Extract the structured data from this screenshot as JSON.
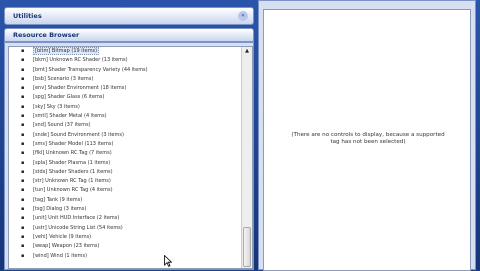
{
  "utilities": {
    "title": "Utilities",
    "toggle_glyph": "«"
  },
  "resource_browser": {
    "title": "Resource Browser",
    "items": [
      "[bitm] Bitmap (19 items)",
      "[bkm] Unknown RC Shader (13 items)",
      "[bmt] Shader Transparency Variety (44 items)",
      "[bsb] Scenario (3 items)",
      "[env] Shader Environment (18 items)",
      "[spg] Shader Glass (6 items)",
      "[sky] Sky (3 items)",
      "[smtl] Shader Metal (4 items)",
      "[snd] Sound (37 items)",
      "[snde] Sound Environment (3 items)",
      "[sms] Shader Model (113 items)",
      "[flkl] Unknown RC Tag (7 items)",
      "[spla] Shader Plasma (1 items)",
      "[stds] Shader Shaders (1 items)",
      "[str] Unknown RC Tag (1 items)",
      "[tun] Unknown RC Tag (4 items)",
      "[tag] Tank (9 items)",
      "[tsg] Dialog (3 items)",
      "[unit] Unit HUD Interface (2 items)",
      "[ustr] Unicode String List (54 items)",
      "[vehi] Vehicle (9 items)",
      "[weap] Weapon (23 items)",
      "[wind] Wind (1 items)"
    ],
    "selected_index": 0
  },
  "scrollbar": {
    "up_arrow": "▲"
  },
  "properties": {
    "message": "(There are no controls to display, because a supported tag has not been selected)"
  }
}
